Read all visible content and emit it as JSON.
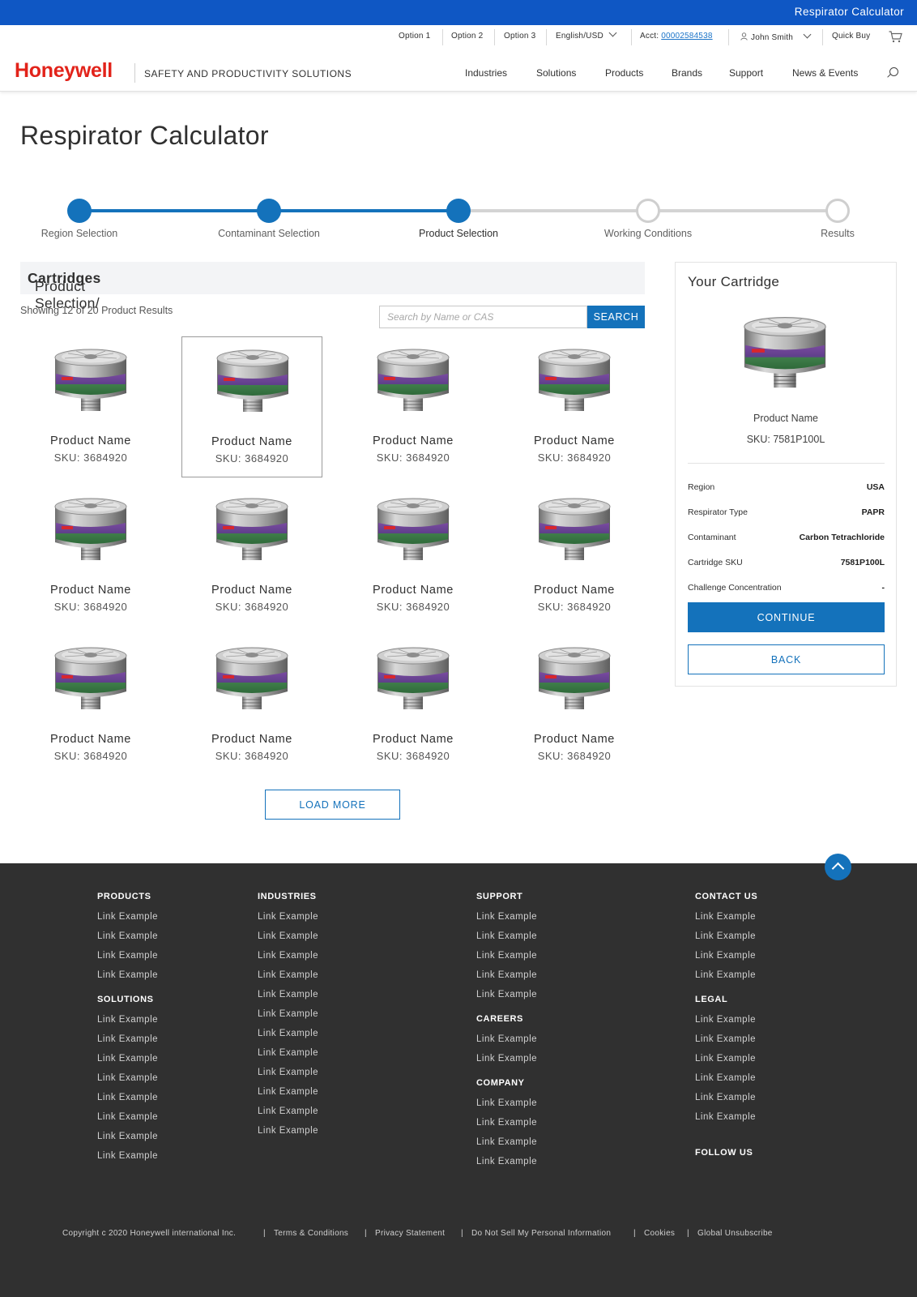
{
  "topbar": {
    "title": "Respirator Calculator"
  },
  "utility_nav": {
    "option1": "Option 1",
    "option2": "Option 2",
    "option3": "Option 3",
    "language": "English/USD",
    "acct_label": "Acct:",
    "acct_number": "00002584538",
    "user": "John Smith",
    "quick_buy": "Quick Buy"
  },
  "header": {
    "logo": "Honeywell",
    "tagline": "SAFETY AND PRODUCTIVITY SOLUTIONS",
    "nav": [
      "Industries",
      "Solutions",
      "Products",
      "Brands",
      "Support",
      "News & Events"
    ]
  },
  "page": {
    "title": "Respirator Calculator"
  },
  "stepper": {
    "steps": [
      {
        "label": "Region Selection",
        "done": true
      },
      {
        "label": "Contaminant Selection",
        "done": true
      },
      {
        "label": "Product Selection",
        "done": true,
        "active": true
      },
      {
        "label": "Working Conditions",
        "done": false
      },
      {
        "label": "Results",
        "done": false
      }
    ]
  },
  "selection": {
    "heading_prefix": "Product Selection/ ",
    "heading_bold": "Cartridges",
    "showing": "Showing 12 of 20 Product Results",
    "search_placeholder": "Search by Name or CAS",
    "search_button": "SEARCH",
    "load_more": "LOAD MORE"
  },
  "products": [
    {
      "name": "Product Name",
      "sku": "SKU: 3684920"
    },
    {
      "name": "Product Name",
      "sku": "SKU: 3684920",
      "selected": true
    },
    {
      "name": "Product Name",
      "sku": "SKU: 3684920"
    },
    {
      "name": "Product Name",
      "sku": "SKU: 3684920"
    },
    {
      "name": "Product Name",
      "sku": "SKU: 3684920"
    },
    {
      "name": "Product Name",
      "sku": "SKU: 3684920"
    },
    {
      "name": "Product Name",
      "sku": "SKU: 3684920"
    },
    {
      "name": "Product Name",
      "sku": "SKU: 3684920"
    },
    {
      "name": "Product Name",
      "sku": "SKU: 3684920"
    },
    {
      "name": "Product Name",
      "sku": "SKU: 3684920"
    },
    {
      "name": "Product Name",
      "sku": "SKU: 3684920"
    },
    {
      "name": "Product Name",
      "sku": "SKU: 3684920"
    }
  ],
  "cartridge_panel": {
    "title": "Your Cartridge",
    "product_name": "Product Name",
    "sku": "SKU: 7581P100L",
    "details": [
      {
        "label": "Region",
        "value": "USA"
      },
      {
        "label": "Respirator Type",
        "value": "PAPR"
      },
      {
        "label": "Contaminant",
        "value": "Carbon Tetrachloride"
      },
      {
        "label": "Cartridge SKU",
        "value": "7581P100L"
      },
      {
        "label": "Challenge Concentration",
        "value": "-"
      }
    ],
    "continue": "CONTINUE",
    "back": "BACK"
  },
  "footer": {
    "columns": [
      {
        "groups": [
          {
            "heading": "PRODUCTS",
            "links": [
              "Link Example",
              "Link Example",
              "Link Example",
              "Link Example"
            ]
          },
          {
            "heading": "SOLUTIONS",
            "links": [
              "Link Example",
              "Link Example",
              "Link Example",
              "Link Example",
              "Link Example",
              "Link Example",
              "Link Example",
              "Link Example"
            ]
          }
        ]
      },
      {
        "groups": [
          {
            "heading": "INDUSTRIES",
            "links": [
              "Link Example",
              "Link Example",
              "Link Example",
              "Link Example",
              "Link Example",
              "Link Example",
              "Link Example",
              "Link Example",
              "Link Example",
              "Link Example",
              "Link Example",
              "Link Example"
            ]
          }
        ]
      },
      {
        "groups": [
          {
            "heading": "SUPPORT",
            "links": [
              "Link Example",
              "Link Example",
              "Link Example",
              "Link Example",
              "Link Example"
            ]
          },
          {
            "heading": "CAREERS",
            "links": [
              "Link Example",
              "Link Example"
            ]
          },
          {
            "heading": "COMPANY",
            "links": [
              "Link Example",
              "Link Example",
              "Link Example",
              "Link Example"
            ]
          }
        ]
      },
      {
        "groups": [
          {
            "heading": "CONTACT US",
            "links": [
              "Link Example",
              "Link Example",
              "Link Example",
              "Link Example"
            ]
          },
          {
            "heading": "LEGAL",
            "links": [
              "Link Example",
              "Link Example",
              "Link Example",
              "Link Example",
              "Link Example",
              "Link Example"
            ]
          },
          {
            "heading": "FOLLOW US",
            "links": []
          }
        ]
      }
    ],
    "legal": [
      "Copyright c  2020 Honeywell international Inc.",
      "Terms & Conditions",
      "Privacy Statement",
      "Do Not Sell My Personal Information",
      "Cookies",
      "Global Unsubscribe"
    ]
  },
  "colors": {
    "brand_red": "#e2231a",
    "topbar_blue": "#0f57c4",
    "accent_blue": "#1472bb",
    "footer_bg": "#303030"
  }
}
